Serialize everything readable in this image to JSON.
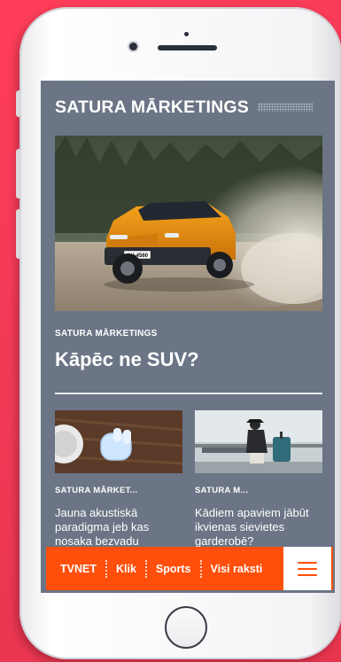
{
  "section": {
    "title": "SATURA MĀRKETINGS"
  },
  "hero": {
    "kicker": "SATURA MĀRKETINGS",
    "title": "Kāpēc ne SUV?",
    "plate_text": "AH-4560"
  },
  "cards": [
    {
      "kicker": "SATURA MĀRKET...",
      "title": "Jauna akustiskā paradigma jeb kas nosaka bezvadu"
    },
    {
      "kicker": "SATURA M...",
      "title": "Kādiem apaviem jābūt ikvienas sievietes garderobē?"
    }
  ],
  "bottom_nav": {
    "items": [
      "TVNET",
      "Klik",
      "Sports",
      "Visi raksti"
    ],
    "menu_icon": "hamburger-menu-icon"
  },
  "colors": {
    "background": "#f23a57",
    "screen": "#6b7585",
    "nav": "#ff4f0a",
    "car": "#e8930f"
  }
}
